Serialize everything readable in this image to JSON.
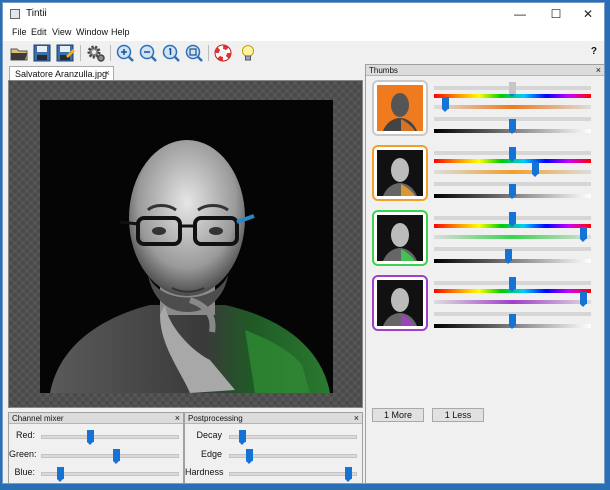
{
  "window": {
    "title": "Tintii",
    "controls": [
      "—",
      "☐",
      "✕"
    ]
  },
  "menu": [
    "File",
    "Edit",
    "View",
    "Window",
    "Help"
  ],
  "toolbar": {
    "buttons": [
      "open-icon",
      "save-icon",
      "save-as-icon",
      "settings-icon",
      "zoom-in-icon",
      "zoom-out-icon",
      "zoom-actual-icon",
      "zoom-fit-icon",
      "help-lifebuoy-icon",
      "tip-lightbulb-icon"
    ],
    "help_label": "?"
  },
  "document_tab": {
    "label": "Salvatore Aranzulla.jpg",
    "close": "×"
  },
  "channel_mixer": {
    "title": "Channel mixer",
    "close": "×",
    "sliders": [
      {
        "label": "Red:",
        "value": 0.35
      },
      {
        "label": "Green:",
        "value": 0.55
      },
      {
        "label": "Blue:",
        "value": 0.12
      }
    ]
  },
  "postprocessing": {
    "title": "Postprocessing",
    "close": "×",
    "sliders": [
      {
        "label": "Decay",
        "value": 0.08
      },
      {
        "label": "Edge",
        "value": 0.14
      },
      {
        "label": "Hardness",
        "value": 0.96
      }
    ]
  },
  "thumbs": {
    "title": "Thumbs",
    "close": "×",
    "groups": [
      {
        "border_color": "#c8c8c8",
        "tint": "#f07a1e",
        "sliders": [
          0.5,
          0.05,
          0.5
        ]
      },
      {
        "border_color": "#f0a028",
        "tint": "#f0a028",
        "sliders": [
          0.5,
          0.65,
          0.5
        ]
      },
      {
        "border_color": "#3cd250",
        "tint": "#3cd250",
        "sliders": [
          0.5,
          0.97,
          0.47
        ]
      },
      {
        "border_color": "#a040c8",
        "tint": "#a040c8",
        "sliders": [
          0.5,
          0.97,
          0.5
        ]
      }
    ],
    "more_label": "1 More",
    "less_label": "1 Less"
  },
  "colors": {
    "accent": "#1673d6",
    "titlebar": "#ffffff",
    "window_bg": "#f0f0f0",
    "desktop": "#2a6fb5"
  }
}
